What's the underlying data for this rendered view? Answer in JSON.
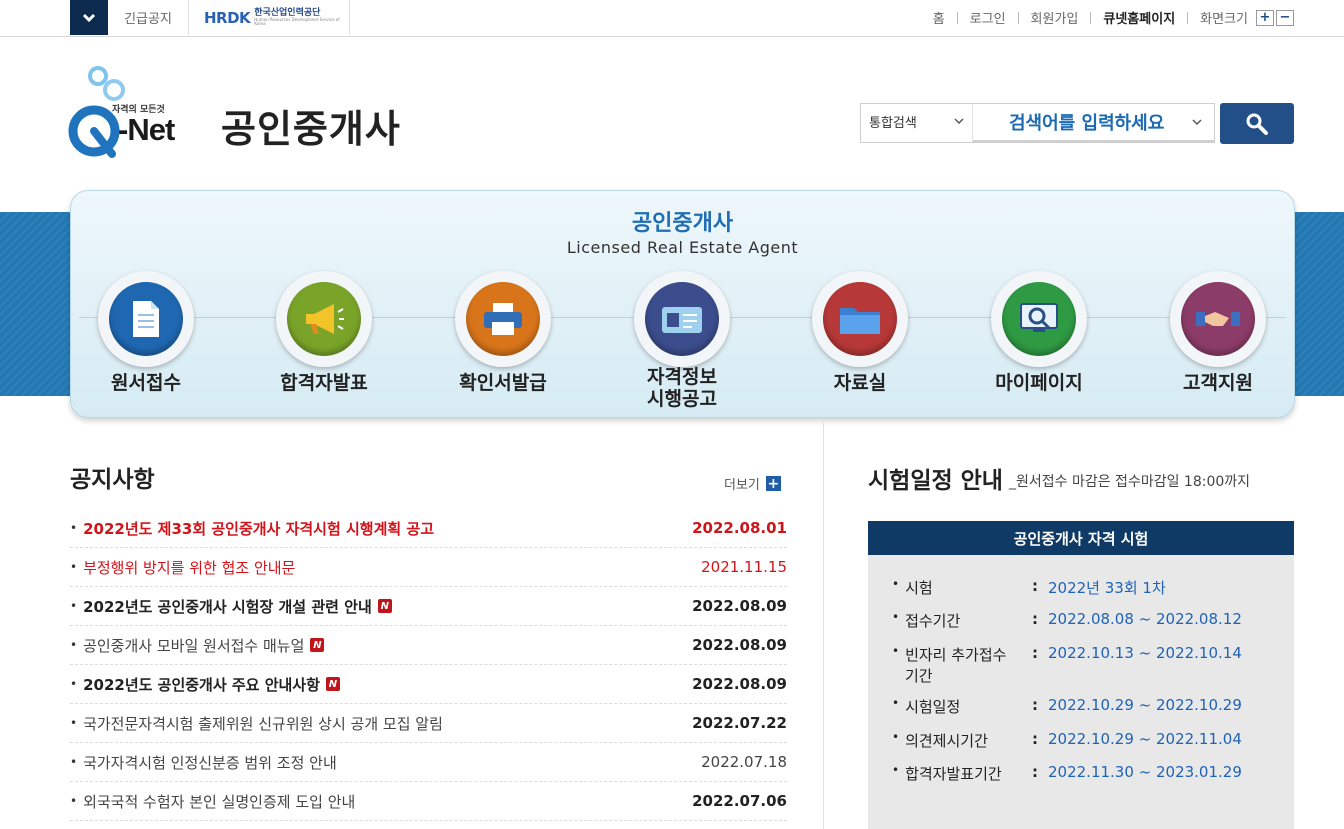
{
  "topbar": {
    "urgent_notice": "긴급공지",
    "hrdk_mark": "HRDK",
    "hrdk_name": "한국산업인력공단",
    "hrdk_eng": "Human Resources Development Service of Korea",
    "links": [
      "홈",
      "로그인",
      "회원가입",
      "큐넷홈페이지",
      "화면크기"
    ],
    "zoom_in": "+",
    "zoom_out": "−"
  },
  "header": {
    "logo_tagline": "자격의 모든것",
    "logo_text": "-Net",
    "page_title": "공인중개사"
  },
  "search": {
    "type_selected": "통합검색",
    "placeholder": "검색어를 입력하세요"
  },
  "hero": {
    "title": "공인중개사",
    "subtitle": "Licensed Real Estate Agent",
    "menu": [
      {
        "label": "원서접수",
        "icon": "document-icon",
        "color": "#1f67b1"
      },
      {
        "label": "합격자발표",
        "icon": "megaphone-icon",
        "color": "#7aa429"
      },
      {
        "label": "확인서발급",
        "icon": "printer-icon",
        "color": "#d8751a"
      },
      {
        "label": "자격정보",
        "label2": "시행공고",
        "icon": "id-card-icon",
        "color": "#3b4d8c"
      },
      {
        "label": "자료실",
        "icon": "folder-icon",
        "color": "#b73838"
      },
      {
        "label": "마이페이지",
        "icon": "monitor-search-icon",
        "color": "#2f9a44"
      },
      {
        "label": "고객지원",
        "icon": "handshake-icon",
        "color": "#8c3c68"
      }
    ]
  },
  "notices": {
    "title": "공지사항",
    "more": "더보기",
    "items": [
      {
        "title": "2022년도 제33회 공인중개사 자격시험 시행계획 공고",
        "date": "2022.08.01",
        "style": "red bold",
        "new": false
      },
      {
        "title": "부정행위 방지를 위한 협조 안내문",
        "date": "2021.11.15",
        "style": "red",
        "new": false
      },
      {
        "title": "2022년도 공인중개사 시험장 개설 관련 안내",
        "date": "2022.08.09",
        "style": "bold",
        "new": true
      },
      {
        "title": "공인중개사 모바일 원서접수 매뉴얼",
        "date": "2022.08.09",
        "style": "bold-date",
        "new": true
      },
      {
        "title": "2022년도 공인중개사 주요 안내사항",
        "date": "2022.08.09",
        "style": "bold",
        "new": true
      },
      {
        "title": "국가전문자격시험 출제위원 신규위원 상시 공개 모집 알림",
        "date": "2022.07.22",
        "style": "bold-date",
        "new": false
      },
      {
        "title": "국가자격시험 인정신분증 범위 조정 안내",
        "date": "2022.07.18",
        "style": "plain",
        "new": false
      },
      {
        "title": "외국국적 수험자 본인 실명인증제 도입 안내",
        "date": "2022.07.06",
        "style": "bold-date",
        "new": false
      }
    ],
    "new_badge": "N"
  },
  "schedule": {
    "title": "시험일정 안내",
    "subtitle": "_원서접수 마감은 접수마감일 18:00까지",
    "box_title": "공인중개사 자격 시험",
    "rows": [
      {
        "key": "시험",
        "value": "2022년 33회 1차"
      },
      {
        "key": "접수기간",
        "value": "2022.08.08 ~ 2022.08.12"
      },
      {
        "key": "빈자리 추가접수",
        "key2": "기간",
        "value": "2022.10.13 ~ 2022.10.14"
      },
      {
        "key": "시험일정",
        "value": "2022.10.29 ~ 2022.10.29"
      },
      {
        "key": "의견제시기간",
        "value": "2022.10.29 ~ 2022.11.04"
      },
      {
        "key": "합격자발표기간",
        "value": "2022.11.30 ~ 2023.01.29"
      }
    ]
  }
}
